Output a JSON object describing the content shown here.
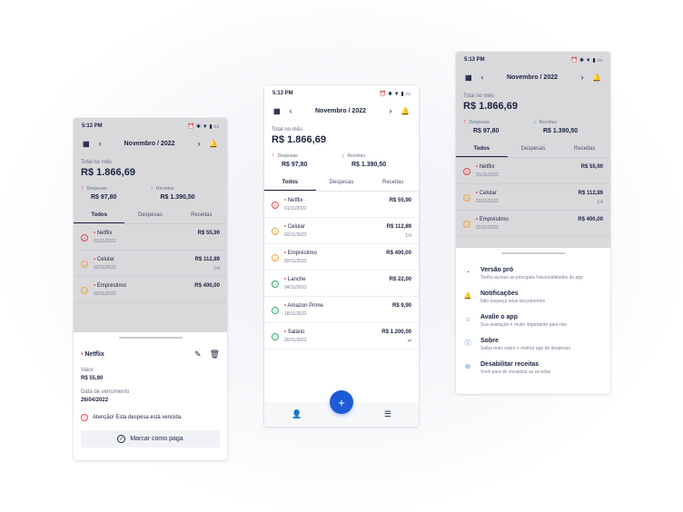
{
  "status_time": "5:13 PM",
  "status_icons": "⏰ ✱ ▼ ▮ ▭",
  "month": "Novembro / 2022",
  "total_label": "Total no mês",
  "total_value": "R$ 1.866,69",
  "expenses_label": "Despesas",
  "expenses_value": "R$ 97,80",
  "income_label": "Receitas",
  "income_value": "R$ 1.390,50",
  "tabs": [
    "Todos",
    "Despesas",
    "Receitas"
  ],
  "transactions": [
    {
      "name": "Netflix",
      "date": "01/11/2022",
      "amount": "R$ 55,90",
      "sub": "",
      "status": "red"
    },
    {
      "name": "Celular",
      "date": "02/11/2022",
      "amount": "R$ 112,89",
      "sub": "1/4",
      "status": "orange"
    },
    {
      "name": "Empréstimo",
      "date": "02/11/2022",
      "amount": "R$ 400,00",
      "sub": "",
      "status": "orange"
    },
    {
      "name": "Lanche",
      "date": "04/11/2022",
      "amount": "R$ 22,00",
      "sub": "",
      "status": "green"
    },
    {
      "name": "Amazon Prime",
      "date": "18/11/2022",
      "amount": "R$ 9,90",
      "sub": "",
      "status": "green"
    },
    {
      "name": "Salário",
      "date": "20/11/2022",
      "amount": "R$ 1.200,00",
      "sub": "⇄",
      "status": "green"
    }
  ],
  "detail": {
    "title": "Netflix",
    "value_label": "Valor",
    "value": "R$ 55,90",
    "due_label": "Data de vencimento",
    "due": "26/04/2022",
    "warning": "Atenção! Esta despesa está vencida.",
    "button": "Marcar como paga"
  },
  "menu": [
    {
      "title": "Versão pró",
      "sub": "Tenha acesso as principais funcionalidades do app",
      "icon": "pro-icon",
      "glyph": "◔"
    },
    {
      "title": "Notificações",
      "sub": "Não esqueça seus lançamentos",
      "icon": "bell-icon",
      "glyph": "🔔"
    },
    {
      "title": "Avalie o app",
      "sub": "Sua avaliação é muito importante para nós",
      "icon": "star-icon",
      "glyph": "☆"
    },
    {
      "title": "Sobre",
      "sub": "Saiba mais sobre o melhor app de despesas",
      "icon": "info-icon",
      "glyph": "ⓘ"
    },
    {
      "title": "Desabilitar receitas",
      "sub": "Você para de visualizar as receitas",
      "icon": "toggle-icon",
      "glyph": "⊝"
    }
  ],
  "colors": {
    "accent": "#1d5bd6",
    "red": "#e5484d",
    "orange": "#f2a33a",
    "green": "#2ea665"
  }
}
